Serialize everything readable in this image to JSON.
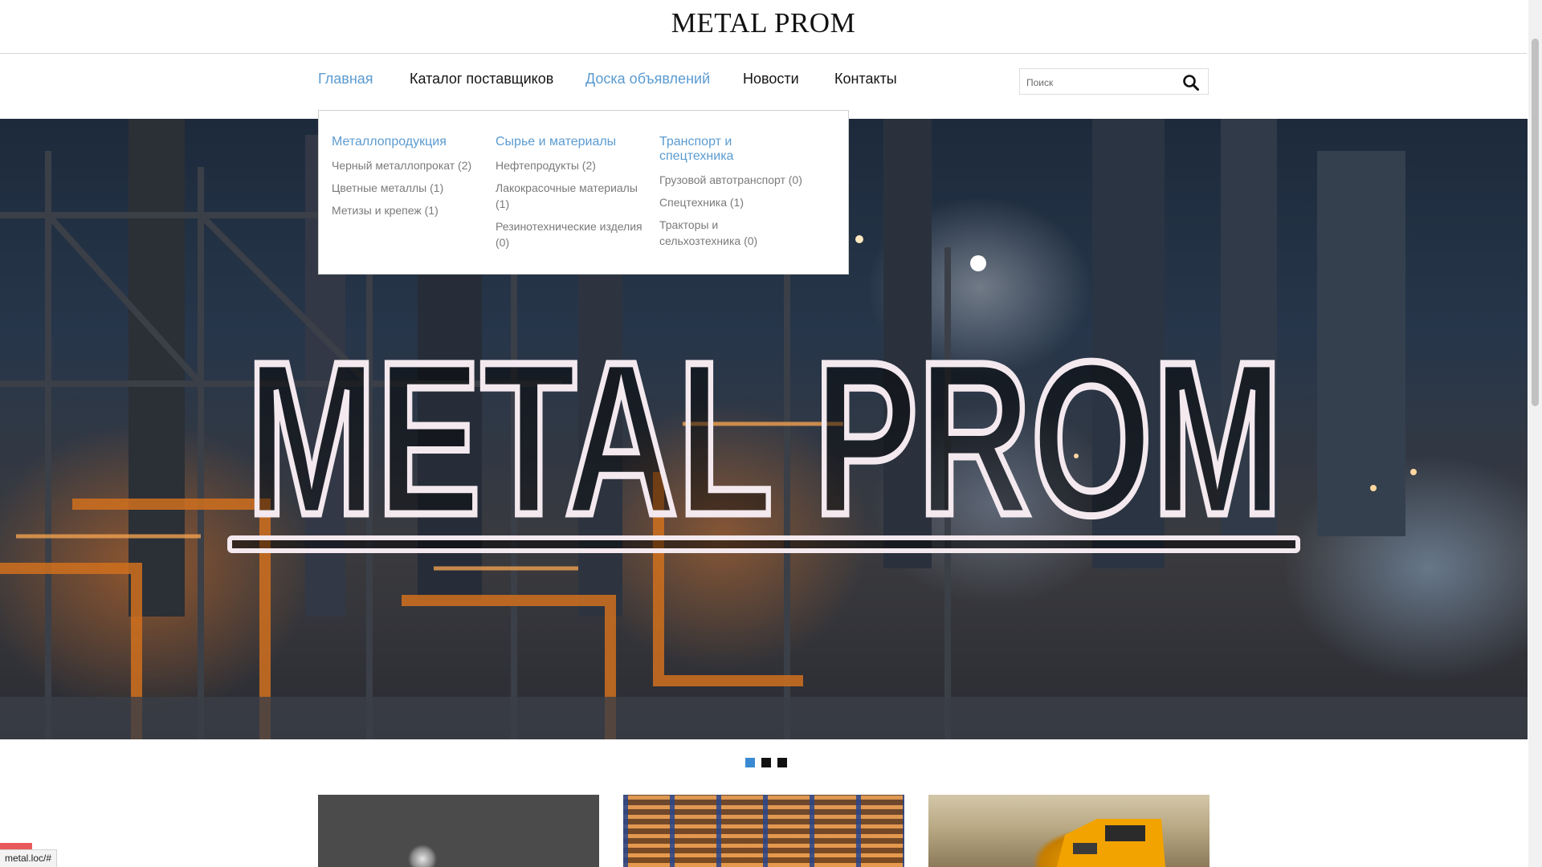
{
  "header": {
    "title": "METAL PROM"
  },
  "nav": [
    {
      "label": "Главная",
      "active": true
    },
    {
      "label": "Каталог поставщиков",
      "active": false
    },
    {
      "label": "Доска объявлений",
      "active": true
    },
    {
      "label": "Новости",
      "active": false
    },
    {
      "label": "Контакты",
      "active": false
    }
  ],
  "search": {
    "placeholder": "Поиск",
    "value": "",
    "icon": "search-icon"
  },
  "dropdown": {
    "columns": [
      {
        "title": "Металлопродукция",
        "items": [
          "Черный металлопрокат (2)",
          "Цветные металлы (1)",
          "Метизы и крепеж (1)"
        ]
      },
      {
        "title": "Сырье и материалы",
        "items": [
          "Нефтепродукты (2)",
          "Лакокрасочные материалы (1)",
          "Резинотехнические изделия (0)"
        ]
      },
      {
        "title": "Транспорт и спецтехника",
        "items": [
          "Грузовой автотранспорт (0)",
          "Спецтехника (1)",
          "Тракторы и сельхозтехника (0)"
        ]
      }
    ]
  },
  "hero": {
    "logo_text": "METAL PROM"
  },
  "carousel": {
    "slides": 3,
    "active_index": 0
  },
  "status_bar": {
    "url": "metal.loc/#"
  },
  "colors": {
    "link_active": "#5b9bd0",
    "nav_text": "#151515",
    "dropdown_item": "#7a7a7a",
    "dot_active": "#3a8ad3",
    "dot_inactive": "#111111"
  }
}
